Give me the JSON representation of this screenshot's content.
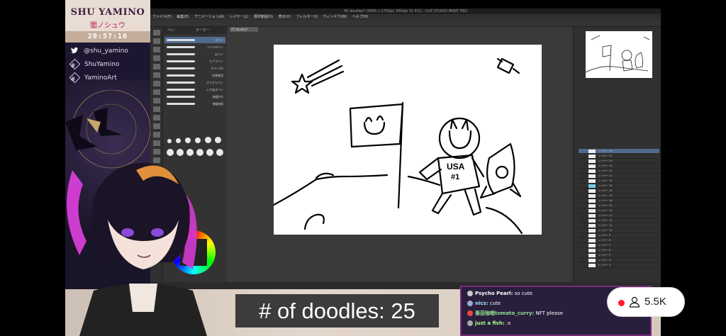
{
  "overlay": {
    "brand_name": "SHU YAMINO",
    "brand_sub": "闇ノシュウ",
    "clock": "20:57:16",
    "socials": [
      {
        "icon": "twitter-icon",
        "label": "@shu_yamino"
      },
      {
        "icon": "hashtag-icon",
        "label": "ShuYamino"
      },
      {
        "icon": "hashtag-icon",
        "label": "YaminoArt"
      }
    ]
  },
  "app": {
    "title": "45 doodles* (4000 x 2700px 300dpi 31.5%) - CLIP STUDIO PAINT PRO",
    "menu": [
      "ファイル(F)",
      "編集(E)",
      "アニメーション(A)",
      "レイヤー(L)",
      "選択範囲(S)",
      "表示(V)",
      "フィルター(I)",
      "ウィンドウ(W)",
      "ヘルプ(H)"
    ],
    "doc_tab": "45 doodles*",
    "subtool_tabs": [
      "ペン",
      "マーカー"
    ],
    "brushes": [
      "Gペン",
      "リアルGペン",
      "丸ペン",
      "カブラペン",
      "Gペン(2)",
      "効果線用",
      "さらさらペン",
      "入り抜きペン",
      "線幅(中)",
      "線幅(細)"
    ],
    "layers": [
      "レイヤー 26",
      "レイヤー 25",
      "レイヤー 24",
      "レイヤー 23",
      "レイヤー 22",
      "レイヤー 21",
      "レイヤー 20",
      "レイヤー 19",
      "レイヤー 18",
      "レイヤー 17",
      "レイヤー 16",
      "レイヤー 15",
      "レイヤー 14",
      "レイヤー 13",
      "レイヤー 12",
      "レイヤー 11",
      "レイヤー 10",
      "レイヤー 9",
      "レイヤー 8",
      "レイヤー 7",
      "レイヤー 6",
      "レイヤー 5",
      "レイヤー 4",
      "レイヤー 3"
    ],
    "canvas_text": "USA\n#1"
  },
  "doodle_counter": "# of doodles: 25",
  "chat": [
    {
      "user": "Psycho Pearl:",
      "msg": "so cute",
      "color": "#e0e0e0"
    },
    {
      "user": "nics:",
      "msg": "cute",
      "color": "#a0e0ff"
    },
    {
      "user": "番茄咖喱tomato_curry:",
      "msg": "NFT please",
      "color": "#8ee08e"
    },
    {
      "user": "just a fish:",
      "msg": ":x",
      "color": "#a8ff8a"
    }
  ],
  "viewers": {
    "count": "5.5K",
    "live_color": "#ff1b2d"
  }
}
